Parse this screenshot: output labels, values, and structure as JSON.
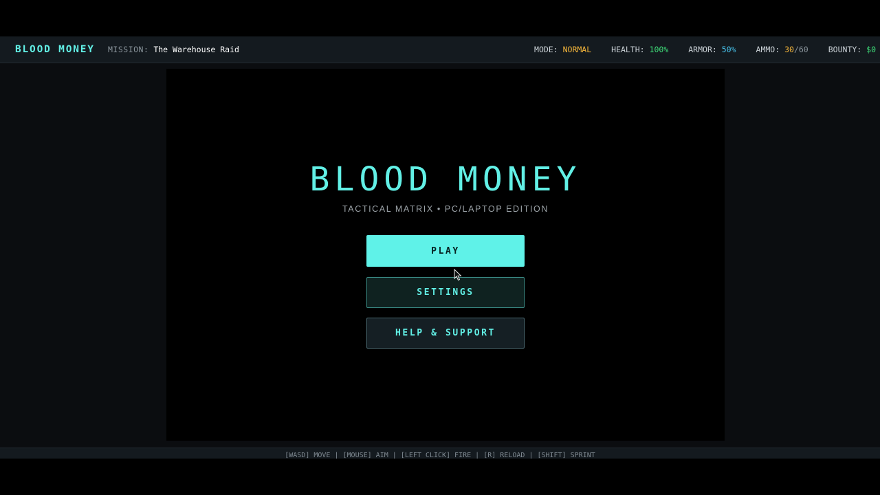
{
  "hud": {
    "brand": "BLOOD MONEY",
    "mission_label": "MISSION:",
    "mission_value": "The Warehouse Raid",
    "mode_label": "MODE:",
    "mode_value": "NORMAL",
    "health_label": "HEALTH:",
    "health_value": "100%",
    "armor_label": "ARMOR:",
    "armor_value": "50%",
    "ammo_label": "AMMO:",
    "ammo_current": "30",
    "ammo_sep": "/",
    "ammo_max": "60",
    "bounty_label": "BOUNTY:",
    "bounty_value": "$0"
  },
  "menu": {
    "title": "BLOOD MONEY",
    "subtitle": "TACTICAL MATRIX • PC/LAPTOP EDITION",
    "play_label": "PLAY",
    "settings_label": "SETTINGS",
    "help_label": "HELP & SUPPORT"
  },
  "footer": {
    "controls": "[WASD] MOVE   |   [MOUSE] AIM   |   [LEFT CLICK] FIRE   |   [R] RELOAD   |   [SHIFT] SPRINT"
  },
  "colors": {
    "accent": "#5ff2e8",
    "gold": "#f5b63b",
    "health": "#3fe07a",
    "armor": "#48c6f0"
  },
  "icons": {
    "cursor": "mouse-pointer-icon"
  }
}
